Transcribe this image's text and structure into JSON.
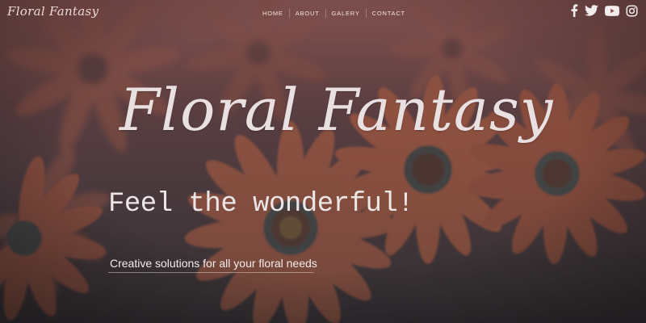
{
  "brand": {
    "logo_text": "Floral Fantasy"
  },
  "nav": {
    "items": [
      {
        "label": "HOME"
      },
      {
        "label": "ABOUT"
      },
      {
        "label": "GALERY"
      },
      {
        "label": "CONTACT"
      }
    ]
  },
  "social": [
    {
      "icon": "facebook-icon"
    },
    {
      "icon": "twitter-icon"
    },
    {
      "icon": "youtube-icon"
    },
    {
      "icon": "instagram-icon"
    }
  ],
  "hero": {
    "title": "Floral Fantasy",
    "tagline": "Feel the wonderful!",
    "subtitle": "Creative solutions for all your floral needs"
  },
  "colors": {
    "overlay_top": "#b0625f",
    "overlay_bottom": "#2f2d30",
    "petal": "#c9613f",
    "text": "#e8e0e1"
  }
}
